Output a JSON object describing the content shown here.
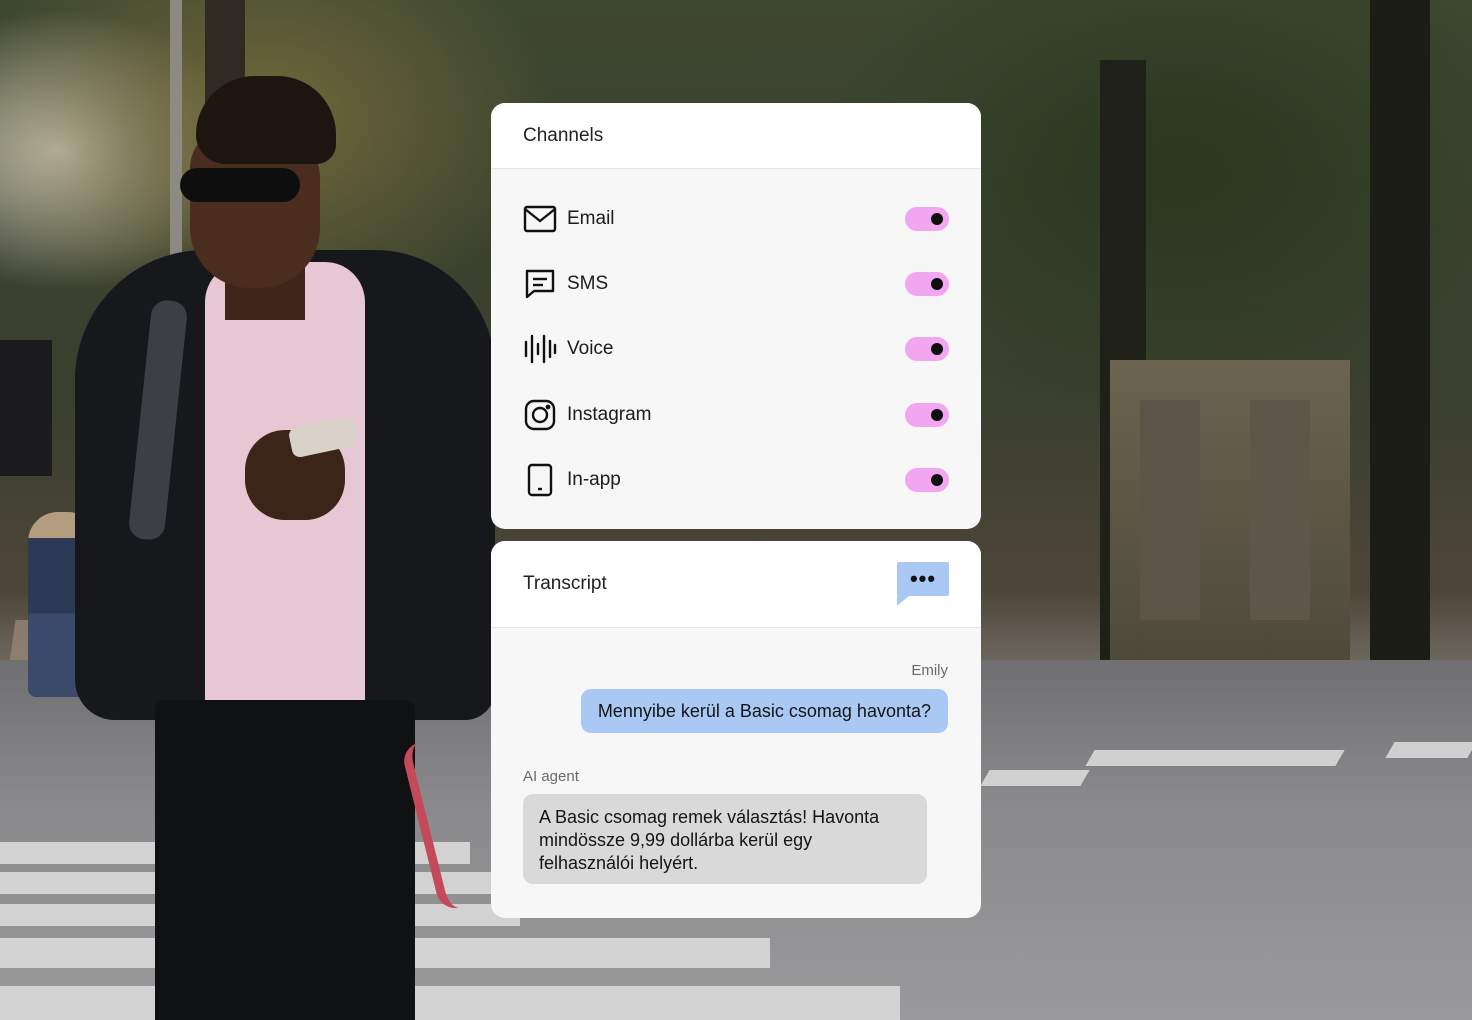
{
  "channels": {
    "title": "Channels",
    "items": [
      {
        "label": "Email",
        "icon": "email-icon",
        "enabled": true
      },
      {
        "label": "SMS",
        "icon": "sms-icon",
        "enabled": true
      },
      {
        "label": "Voice",
        "icon": "voice-icon",
        "enabled": true
      },
      {
        "label": "Instagram",
        "icon": "instagram-icon",
        "enabled": true
      },
      {
        "label": "In-app",
        "icon": "in-app-icon",
        "enabled": true
      }
    ]
  },
  "transcript": {
    "title": "Transcript",
    "more_label": "•••",
    "messages": [
      {
        "sender": "Emily",
        "text": "Mennyibe kerül a Basic csomag havonta?"
      },
      {
        "sender": "AI agent",
        "text": "A Basic csomag remek választás! Havonta mindössze 9,99 dollárba kerül egy felhasználói helyért."
      }
    ]
  },
  "colors": {
    "toggle_on": "#f2a6f0",
    "user_bubble": "#a9c9f4",
    "agent_bubble": "#d9d9d9",
    "card_background": "#f7f7f7"
  }
}
